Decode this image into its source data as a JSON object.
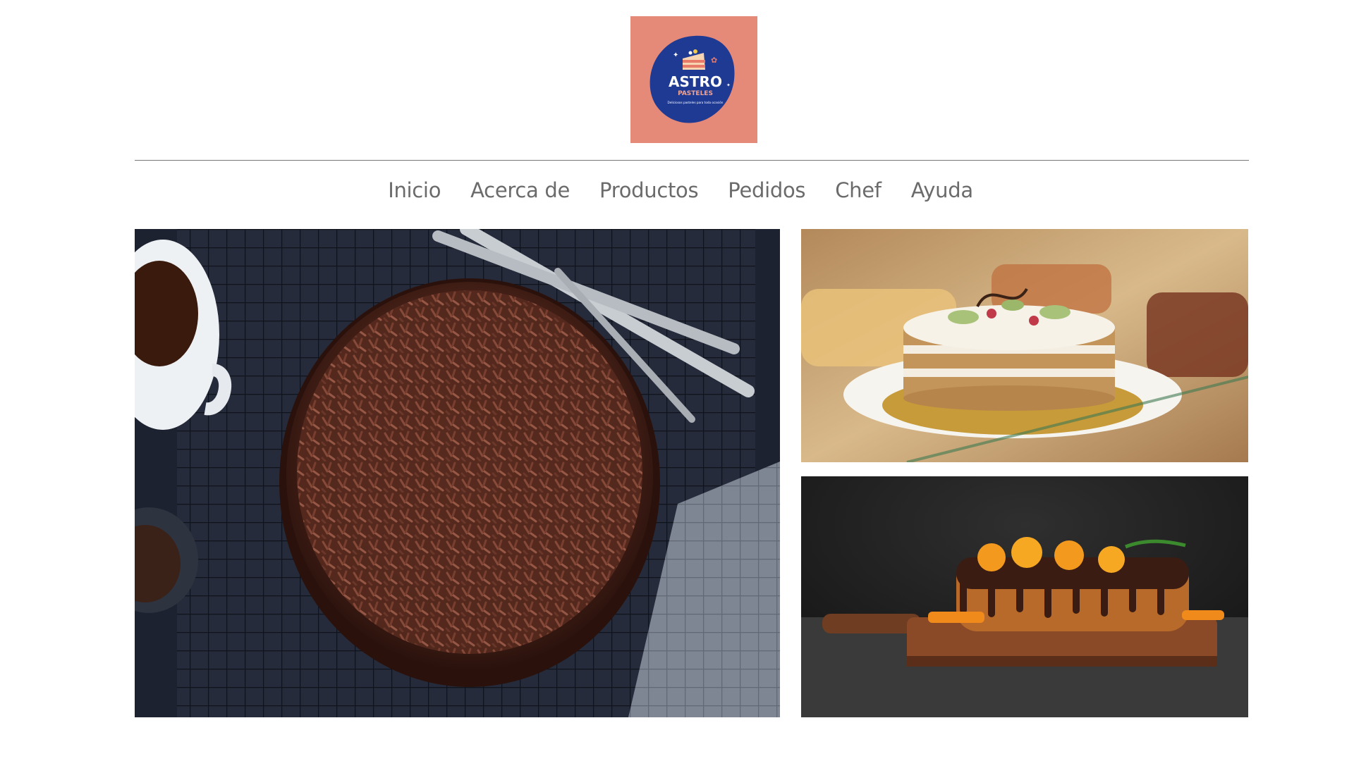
{
  "brand": {
    "logo_title": "ASTRO",
    "logo_subtitle": "PASTELES",
    "logo_tagline": "Deliciosos pasteles para toda ocasión",
    "logo_bg_color": "#e58a79",
    "logo_badge_color": "#1f3a93"
  },
  "nav": {
    "items": [
      {
        "label": "Inicio"
      },
      {
        "label": "Acerca de"
      },
      {
        "label": "Productos"
      },
      {
        "label": "Pedidos"
      },
      {
        "label": "Chef"
      },
      {
        "label": "Ayuda"
      }
    ]
  },
  "gallery": {
    "images": [
      {
        "subject": "chocolate-cake-photo"
      },
      {
        "subject": "layered-cream-cake-photo"
      },
      {
        "subject": "orange-loaf-cake-photo"
      }
    ]
  }
}
